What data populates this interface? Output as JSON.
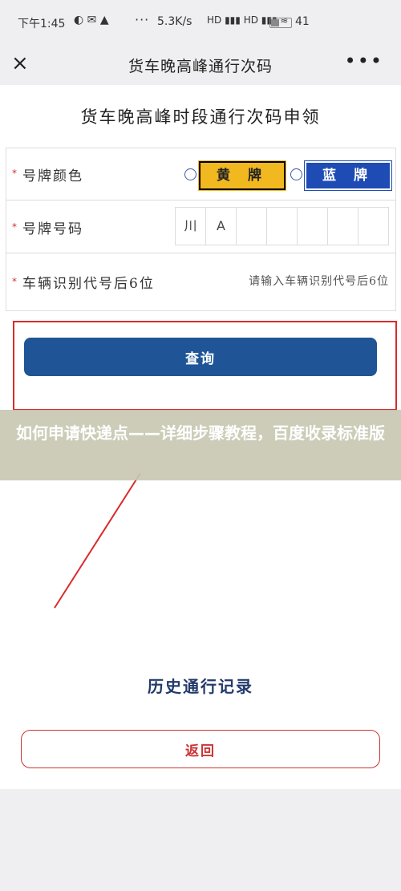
{
  "status_bar": {
    "time": "下午1:45",
    "icons": "◐ ✉ ▲",
    "speed": "5.3K/s",
    "signal": "HD ▮▮▮ HD ▮▮▮ ≋",
    "battery_text": "41",
    "battery_percent": 41
  },
  "nav": {
    "close_icon": "×",
    "title": "货车晚高峰通行次码",
    "more_icon": "•••"
  },
  "form": {
    "title": "货车晚高峰时段通行次码申领",
    "required_mark": "*",
    "plate_color_label": "号牌颜色",
    "yellow_plate": "黄 牌",
    "blue_plate": "蓝 牌",
    "plate_number_label": "号牌号码",
    "plate_cells": [
      "川",
      "A",
      "",
      "",
      "",
      "",
      ""
    ],
    "vin_label": "车辆识别代号后6位",
    "vin_placeholder": "请输入车辆识别代号后6位"
  },
  "query_button": "查询",
  "overlay_text": "如何申请快递点——详细步骤教程，百度收录标准版",
  "history_title": "历史通行记录",
  "back_button": "返回"
}
